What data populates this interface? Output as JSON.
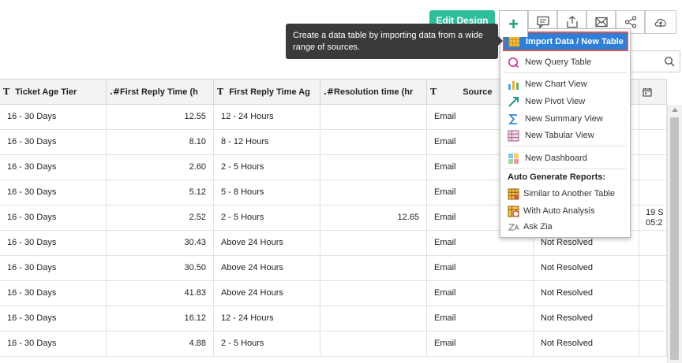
{
  "toolbar": {
    "edit_design_label": "Edit Design",
    "add_symbol": "+",
    "icons": [
      "comment-icon",
      "export-icon",
      "email-icon",
      "share-icon",
      "cloud-upload-icon"
    ]
  },
  "tooltip": {
    "text": "Create a data table by importing data from a wide range of sources."
  },
  "table": {
    "columns": [
      {
        "type": "T",
        "label": "Ticket Age Tier"
      },
      {
        "type": ".#",
        "label": "First Reply Time (h"
      },
      {
        "type": "T",
        "label": "First Reply Time Ag"
      },
      {
        "type": ".#",
        "label": "Resolution time (hr"
      },
      {
        "type": "T",
        "label": "Source"
      }
    ],
    "rows": [
      {
        "tier": "16 - 30 Days",
        "frt": "12.55",
        "frt_age": "12 - 24 Hours",
        "res": "",
        "source": "Email",
        "status": "",
        "date": ""
      },
      {
        "tier": "16 - 30 Days",
        "frt": "8.10",
        "frt_age": "8 - 12 Hours",
        "res": "",
        "source": "Email",
        "status": "",
        "date": ""
      },
      {
        "tier": "16 - 30 Days",
        "frt": "2.60",
        "frt_age": "2 - 5 Hours",
        "res": "",
        "source": "Email",
        "status": "",
        "date": ""
      },
      {
        "tier": "16 - 30 Days",
        "frt": "5.12",
        "frt_age": "5 - 8 Hours",
        "res": "",
        "source": "Email",
        "status": "",
        "date": ""
      },
      {
        "tier": "16 - 30 Days",
        "frt": "2.52",
        "frt_age": "2 - 5 Hours",
        "res": "12.65",
        "source": "Email",
        "status": "",
        "date": "19 S",
        "date2": "05:2"
      },
      {
        "tier": "16 - 30 Days",
        "frt": "30.43",
        "frt_age": "Above 24 Hours",
        "res": "",
        "source": "Email",
        "status": "Not Resolved",
        "date": ""
      },
      {
        "tier": "16 - 30 Days",
        "frt": "30.50",
        "frt_age": "Above 24 Hours",
        "res": "",
        "source": "Email",
        "status": "Not Resolved",
        "date": ""
      },
      {
        "tier": "16 - 30 Days",
        "frt": "41.83",
        "frt_age": "Above 24 Hours",
        "res": "",
        "source": "Email",
        "status": "Not Resolved",
        "date": ""
      },
      {
        "tier": "16 - 30 Days",
        "frt": "16.12",
        "frt_age": "12 - 24 Hours",
        "res": "",
        "source": "Email",
        "status": "Not Resolved",
        "date": ""
      },
      {
        "tier": "16 - 30 Days",
        "frt": "4.88",
        "frt_age": "2 - 5 Hours",
        "res": "",
        "source": "Email",
        "status": "Not Resolved",
        "date": ""
      }
    ]
  },
  "menu": {
    "items": [
      {
        "label": "Import Data / New Table",
        "icon": "import-table-icon"
      },
      {
        "label": "New Query Table",
        "icon": "query-table-icon"
      },
      {
        "label": "New Chart View",
        "icon": "chart-view-icon"
      },
      {
        "label": "New Pivot View",
        "icon": "pivot-view-icon"
      },
      {
        "label": "New Summary View",
        "icon": "summary-view-icon"
      },
      {
        "label": "New Tabular View",
        "icon": "tabular-view-icon"
      },
      {
        "label": "New Dashboard",
        "icon": "dashboard-icon"
      }
    ],
    "auto_header": "Auto Generate Reports:",
    "auto_items": [
      {
        "label": "Similar to Another Table",
        "icon": "similar-table-icon"
      },
      {
        "label": "With Auto Analysis",
        "icon": "auto-analysis-icon"
      },
      {
        "label": "Ask Zia",
        "icon": "zia-icon"
      }
    ]
  },
  "colors": {
    "accent_green": "#2fbe9c",
    "menu_selected": "#2d7fd8",
    "highlight_border": "#e05454"
  }
}
